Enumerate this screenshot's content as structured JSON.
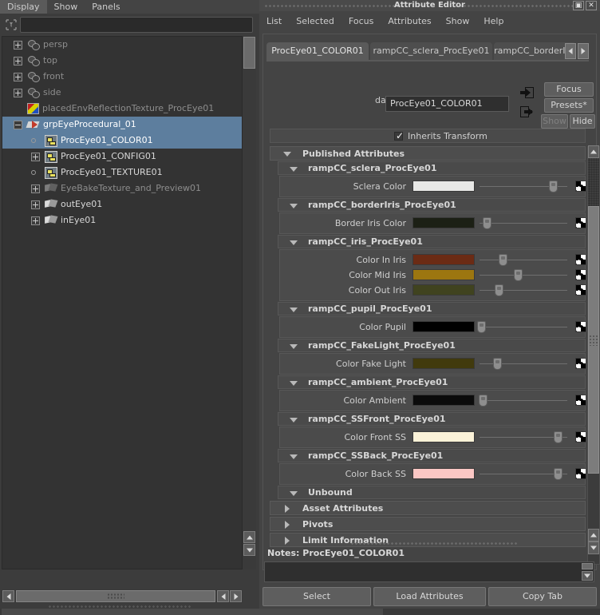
{
  "outliner": {
    "menus": [
      "Display",
      "Show",
      "Panels"
    ],
    "search_value": "",
    "search_placeholder": "",
    "tree": [
      {
        "label": "persp",
        "icon": "camera-icon",
        "expander": "plus",
        "indent": 0,
        "dim": true,
        "selected": false
      },
      {
        "label": "top",
        "icon": "camera-icon",
        "expander": "plus",
        "indent": 0,
        "dim": true,
        "selected": false
      },
      {
        "label": "front",
        "icon": "camera-icon",
        "expander": "plus",
        "indent": 0,
        "dim": true,
        "selected": false
      },
      {
        "label": "side",
        "icon": "camera-icon",
        "expander": "plus",
        "indent": 0,
        "dim": true,
        "selected": false
      },
      {
        "label": "placedEnvReflectionTexture_ProcEye01",
        "icon": "texture-icon",
        "expander": "none",
        "indent": 0,
        "dim": true,
        "selected": false
      },
      {
        "label": "grpEyeProcedural_01",
        "icon": "group-icon",
        "expander": "minus",
        "indent": 0,
        "dim": false,
        "selected": true
      },
      {
        "label": "ProcEye01_COLOR01",
        "icon": "container-node-icon",
        "expander": "dot",
        "indent": 1,
        "dim": false,
        "selected": true
      },
      {
        "label": "ProcEye01_CONFIG01",
        "icon": "container-node-icon",
        "expander": "plus",
        "indent": 1,
        "dim": false,
        "selected": false
      },
      {
        "label": "ProcEye01_TEXTURE01",
        "icon": "container-node-icon",
        "expander": "dot",
        "indent": 1,
        "dim": false,
        "selected": false
      },
      {
        "label": "EyeBakeTexture_and_Preview01",
        "icon": "mesh-icon",
        "expander": "plus",
        "indent": 1,
        "dim": true,
        "selected": false
      },
      {
        "label": "outEye01",
        "icon": "mesh-icon",
        "expander": "plus",
        "indent": 1,
        "dim": false,
        "selected": false
      },
      {
        "label": "inEye01",
        "icon": "mesh-icon",
        "expander": "plus",
        "indent": 1,
        "dim": false,
        "selected": false
      }
    ]
  },
  "attribute_editor": {
    "window_title": "Attribute Editor",
    "window_buttons": [
      "restore-icon",
      "close-icon"
    ],
    "menus": [
      "List",
      "Selected",
      "Focus",
      "Attributes",
      "Show",
      "Help"
    ],
    "tabs": [
      {
        "label": "ProcEye01_COLOR01",
        "active": true
      },
      {
        "label": "rampCC_sclera_ProcEye01",
        "active": false
      },
      {
        "label": "rampCC_borderIris",
        "active": false
      }
    ],
    "tab_nav": [
      "prev-tab-arrow",
      "next-tab-arrow"
    ],
    "dag_container": {
      "label": "dagContainer:",
      "value": "ProcEye01_COLOR01"
    },
    "side_buttons": {
      "focus": "Focus",
      "presets": "Presets*",
      "show": "Show",
      "hide": "Hide"
    },
    "inherits_transform": {
      "label": "Inherits Transform",
      "checked": true
    },
    "published_attributes": {
      "label": "Published Attributes",
      "open": true,
      "groups": [
        {
          "name": "rampCC_sclera_ProcEye01",
          "open": true,
          "attrs": [
            {
              "label": "Sclera Color",
              "color": "#e8e8e6",
              "slider": 0.85
            }
          ]
        },
        {
          "name": "rampCC_borderIris_ProcEye01",
          "open": true,
          "attrs": [
            {
              "label": "Border Iris Color",
              "color": "#1c2015",
              "slider": 0.08
            }
          ]
        },
        {
          "name": "rampCC_iris_ProcEye01",
          "open": true,
          "attrs": [
            {
              "label": "Color In Iris",
              "color": "#6b2b14",
              "slider": 0.27
            },
            {
              "label": "Color Mid Iris",
              "color": "#9c7610",
              "slider": 0.44
            },
            {
              "label": "Color Out Iris",
              "color": "#40431f",
              "slider": 0.22
            }
          ]
        },
        {
          "name": "rampCC_pupil_ProcEye01",
          "open": true,
          "attrs": [
            {
              "label": "Color Pupil",
              "color": "#000000",
              "slider": 0.02
            }
          ]
        },
        {
          "name": "rampCC_FakeLight_ProcEye01",
          "open": true,
          "attrs": [
            {
              "label": "Color Fake Light",
              "color": "#413a0d",
              "slider": 0.2
            }
          ]
        },
        {
          "name": "rampCC_ambient_ProcEye01",
          "open": true,
          "attrs": [
            {
              "label": "Color Ambient",
              "color": "#0b0b0b",
              "slider": 0.04
            }
          ]
        },
        {
          "name": "rampCC_SSFront_ProcEye01",
          "open": true,
          "attrs": [
            {
              "label": "Color Front SS",
              "color": "#fbf2d8",
              "slider": 0.91
            }
          ]
        },
        {
          "name": "rampCC_SSBack_ProcEye01",
          "open": true,
          "attrs": [
            {
              "label": "Color Back SS",
              "color": "#fbc7c4",
              "slider": 0.91
            }
          ]
        }
      ],
      "unbound": {
        "label": "Unbound",
        "open": false
      }
    },
    "collapsed_sections": [
      {
        "label": "Asset Attributes",
        "open": false
      },
      {
        "label": "Pivots",
        "open": false
      },
      {
        "label": "Limit Information",
        "open": false
      }
    ],
    "notes": {
      "label": "Notes:",
      "node": "ProcEye01_COLOR01",
      "value": ""
    },
    "bottom_buttons": [
      "Select",
      "Load Attributes",
      "Copy Tab"
    ]
  }
}
